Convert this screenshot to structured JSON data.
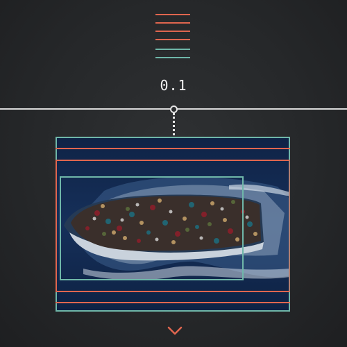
{
  "threshold": {
    "value_label": "0.1"
  },
  "colors": {
    "accent_red": "#e0664f",
    "accent_teal": "#6fb7a9",
    "track": "#d9d9d9",
    "background": "#2a2c2e"
  },
  "legend": {
    "swatches": [
      "#e0664f",
      "#e0664f",
      "#e0664f",
      "#e0664f",
      "#6fb7a9",
      "#6fb7a9"
    ]
  },
  "icons": {
    "next": "chevron-down-icon"
  }
}
